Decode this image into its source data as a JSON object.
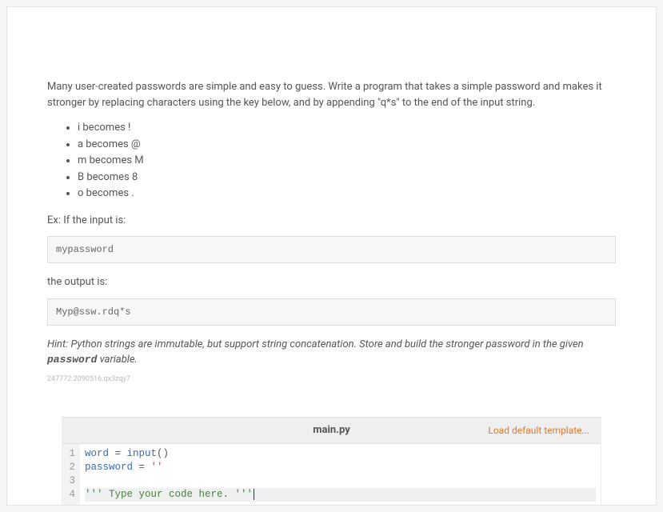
{
  "intro": "Many user-created passwords are simple and easy to guess. Write a program that takes a simple password and makes it stronger by replacing characters using the key below, and by appending \"q*s\" to the end of the input string.",
  "rules": [
    "i becomes !",
    "a becomes @",
    "m becomes M",
    "B becomes 8",
    "o becomes ."
  ],
  "example_label": "Ex: If the input is:",
  "example_input": "mypassword",
  "output_label": "the output is:",
  "example_output": "Myp@ssw.rdq*s",
  "hint_prefix": "Hint: Python strings are immutable, but support string concatenation. Store and build the stronger password in the given ",
  "hint_var": "password",
  "hint_suffix": " variable.",
  "tiny_id": "247772.2090516.qx3zqy7",
  "editor": {
    "filename": "main.py",
    "load_link": "Load default template...",
    "lines": {
      "l1_word": "word",
      "l1_eq": " = ",
      "l1_input": "input",
      "l1_paren": "()",
      "l2_pw": "password",
      "l2_eq": " = ",
      "l2_str": "''",
      "l4_open": "''' ",
      "l4_text": "Type your code here.",
      "l4_close": " '''"
    }
  }
}
